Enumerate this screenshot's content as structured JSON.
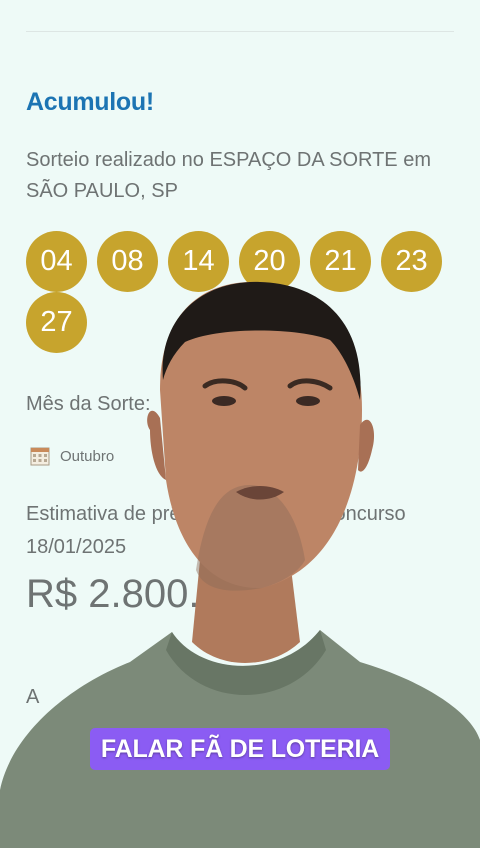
{
  "result": {
    "status_title": "Acumulou!",
    "draw_info": "Sorteio realizado no ESPAÇO DA SORTE em SÃO PAULO, SP",
    "numbers": [
      "04",
      "08",
      "14",
      "20",
      "21",
      "23",
      "27"
    ],
    "ball_color": "#c7a42d",
    "accent_color": "#1c74b3"
  },
  "month_of_luck": {
    "label": "Mês da Sorte:",
    "icon": "calendar-icon",
    "value": "Outubro"
  },
  "estimate": {
    "label_visible": "Estimativa de prê",
    "label_visible_tail": "concurso",
    "date": "18/01/2025",
    "prize_visible": "R$ 2.800."
  },
  "partial_letter": "A",
  "caption": {
    "text": "FALAR FÃ DE LOTERIA",
    "background_color": "#8b5cf3"
  }
}
